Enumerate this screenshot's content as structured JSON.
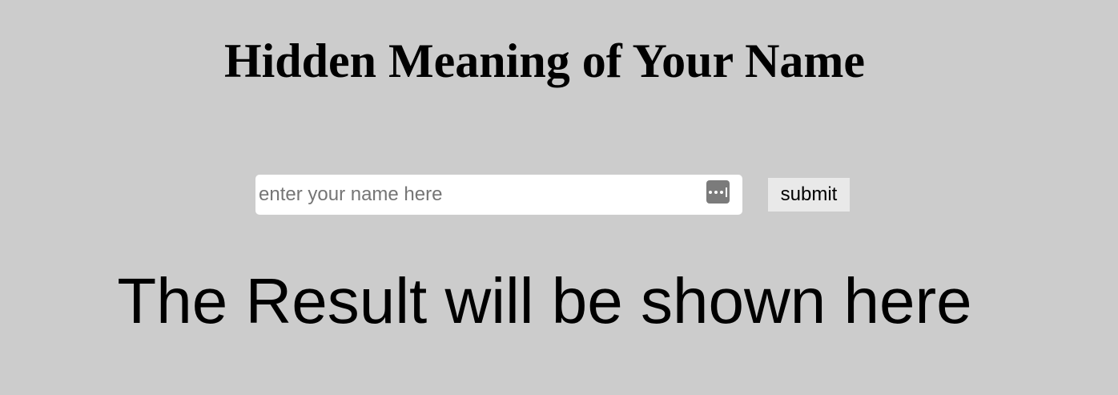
{
  "page": {
    "title": "Hidden Meaning of Your Name",
    "result_text": "The Result will be shown here"
  },
  "form": {
    "name_placeholder": "enter your name here",
    "name_value": "",
    "submit_label": "submit",
    "autofill_icon": "password-manager-key-icon"
  },
  "colors": {
    "background": "#cccccc",
    "input_background": "#ffffff",
    "button_background": "#e9e9e9",
    "text": "#000000"
  }
}
